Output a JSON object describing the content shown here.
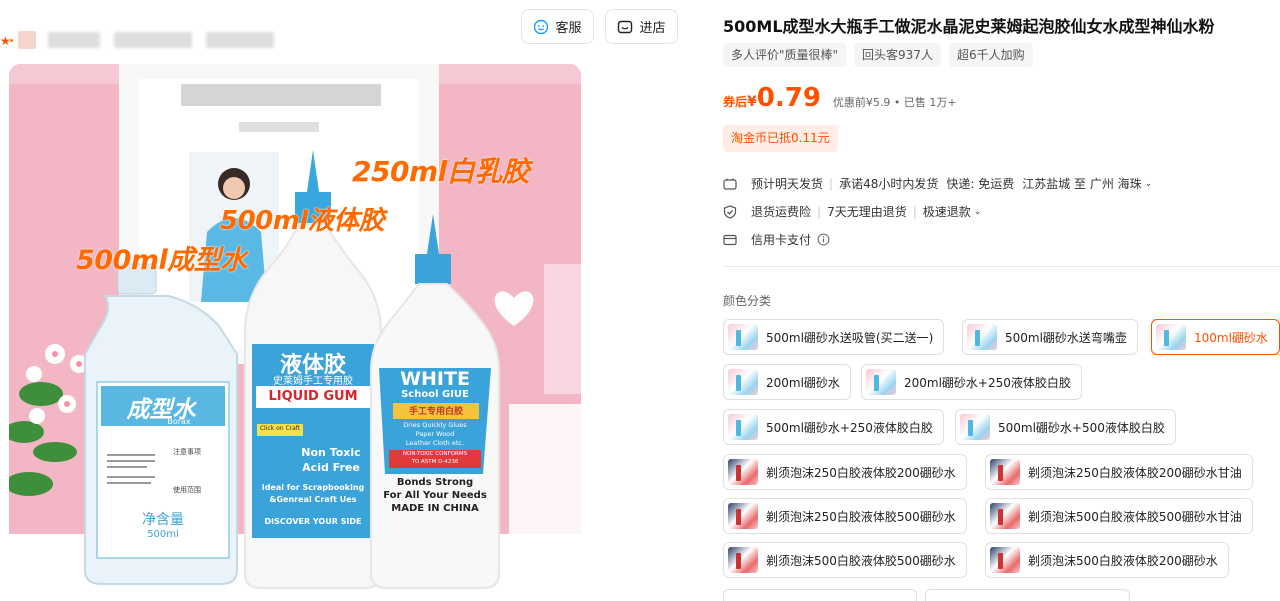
{
  "header": {
    "service_btn": "客服",
    "store_btn": "进店"
  },
  "product": {
    "title": "500ML成型水大瓶手工做泥水晶泥史莱姆起泡胶仙女水成型神仙水粉",
    "tags": [
      "多人评价\"质量很棒\"",
      "回头客937人",
      "超6千人加购"
    ],
    "price": {
      "prefix": "券后",
      "currency": "¥",
      "value": "0.79",
      "meta": "优惠前¥5.9 • 已售 1万+"
    },
    "coin_badge": "淘金币已抵0.11元",
    "shipping": {
      "eta": "预计明天发货",
      "promise": "承诺48小时内发货",
      "fee": "快递: 免运费",
      "route": "江苏盐城 至 广州 海珠"
    },
    "returns": {
      "insurance": "退货运费险",
      "no_reason": "7天无理由退货",
      "refund": "极速退款"
    },
    "payment": "信用卡支付"
  },
  "hero": {
    "annot_250": "250ml白乳胶",
    "annot_500glue": "500ml液体胶",
    "annot_500water": "500ml成型水",
    "bottle1_title": "成型水",
    "bottle1_sub": "Borax",
    "bottle1_net": "净含量",
    "bottle1_vol": "500ml",
    "bottle1_note1": "注意事项",
    "bottle1_note2": "使用范围",
    "bottle2_title": "液体胶",
    "bottle2_sub": "史莱姆手工专用胶",
    "bottle2_name": "LIQUID GUM",
    "bottle2_tag": "Click on Craft",
    "bottle2_l1": "Non Toxic",
    "bottle2_l2": "Acid Free",
    "bottle2_l3": "Ideal for Scrapbooking",
    "bottle2_l4": "&Genreal Craft Ues",
    "bottle2_l5": "DISCOVER YOUR SIDE",
    "bottle3_title": "WHITE",
    "bottle3_sub": "School GIUE",
    "bottle3_cn": "手工专用白胶",
    "bottle3_l1": "Dries Quickly Glues",
    "bottle3_l2": "Paper Wood",
    "bottle3_l3": "Leather Cloth etc.",
    "bottle3_l4": "NON-TOXIC CONFORMS",
    "bottle3_l5": "TO ASTM D-4236",
    "bottle3_l6": "Bonds Strong",
    "bottle3_l7": "For All Your Needs",
    "bottle3_l8": "MADE IN CHINA"
  },
  "sku": {
    "label": "颜色分类",
    "options": [
      "500ml硼砂水送吸管(买二送一)",
      "500ml硼砂水送弯嘴壶",
      "100ml硼砂水",
      "200ml硼砂水",
      "200ml硼砂水+250液体胶白胶",
      "500ml硼砂水+250液体胶白胶",
      "500ml硼砂水+500液体胶白胶",
      "剃须泡沫250白胶液体胶200硼砂水",
      "剃须泡沫250白胶液体胶200硼砂水甘油",
      "剃须泡沫250白胶液体胶500硼砂水",
      "剃须泡沫500白胶液体胶500硼砂水甘油",
      "剃须泡沫500白胶液体胶500硼砂水",
      "剃须泡沫500白胶液体胶200硼砂水"
    ],
    "selected_index": 2
  },
  "colors": {
    "accent": "#ff5000",
    "annotation": "#ff6a00",
    "hero_bg": "#f3b9c6"
  }
}
